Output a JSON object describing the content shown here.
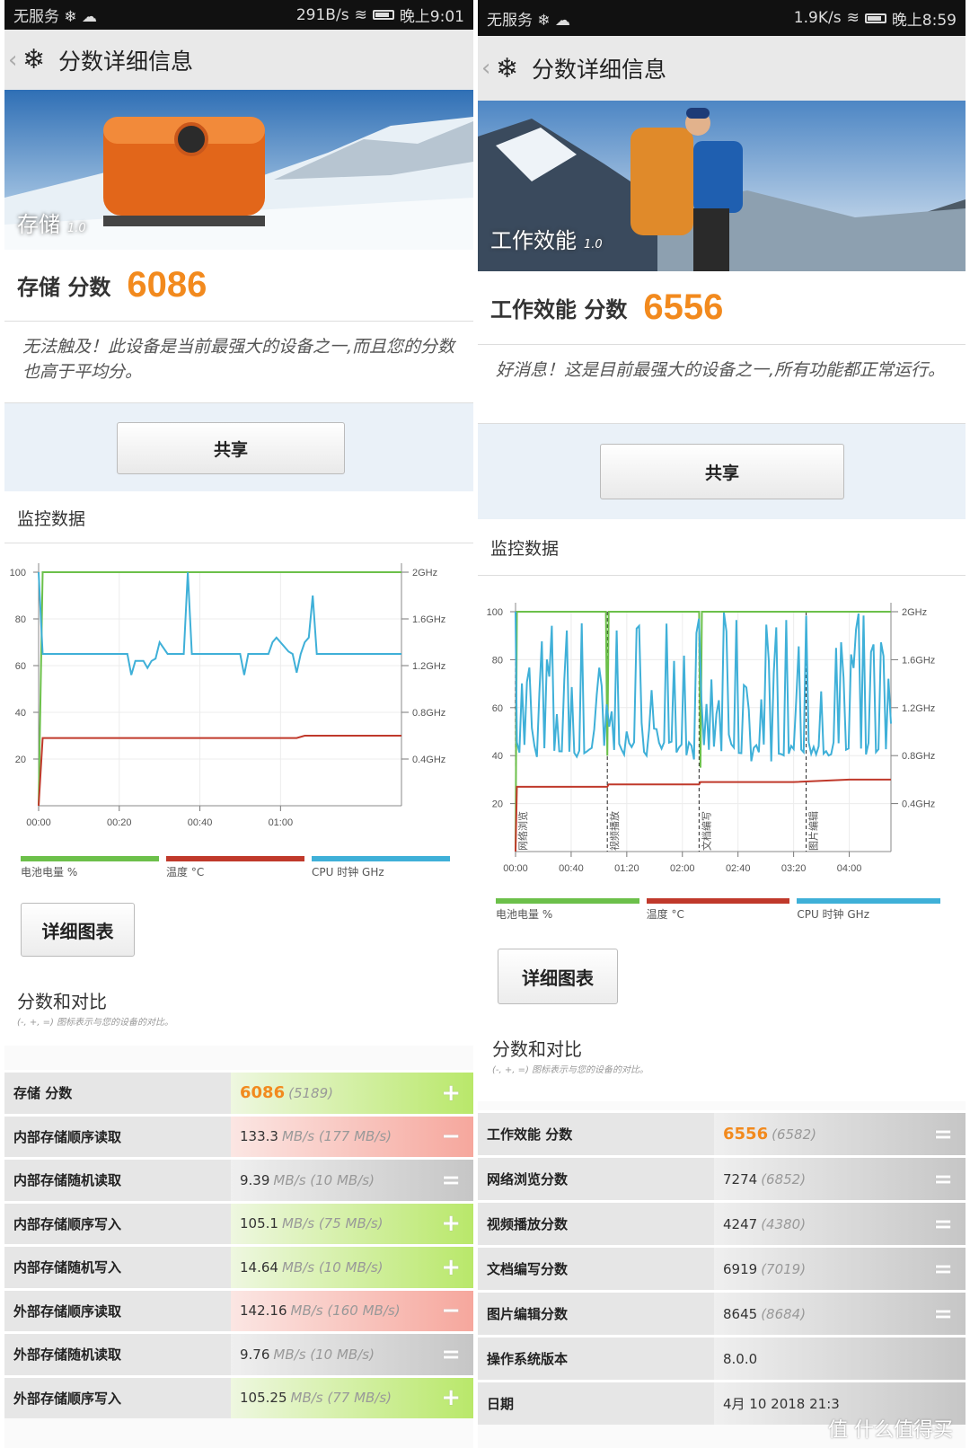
{
  "left": {
    "status": {
      "carrier": "无服务 ❄ ☁",
      "speed": "291B/s",
      "time": "晚上9:01"
    },
    "header_title": "分数详细信息",
    "hero_label": "存储",
    "hero_version": "1.0",
    "score_name": "存储 分数",
    "score_value": "6086",
    "message": "无法触及！此设备是当前最强大的设备之一,而且您的分数也高于平均分。",
    "share_label": "共享",
    "monitor_title": "监控数据",
    "legend": [
      "电池电量 %",
      "温度 °C",
      "CPU 时钟 GHz"
    ],
    "detail_button": "详细图表",
    "compare_title": "分数和对比",
    "compare_sub": "(-, +, =) 图标表示与您的设备的对比。",
    "rows": [
      {
        "k": "存储 分数",
        "v": "6086",
        "u": "(5189)",
        "sym": "+",
        "grad": "plus",
        "big": true
      },
      {
        "k": "内部存储顺序读取",
        "v": "133.3",
        "u": "MB/s (177 MB/s)",
        "sym": "−",
        "grad": "minus"
      },
      {
        "k": "内部存储随机读取",
        "v": "9.39",
        "u": "MB/s (10 MB/s)",
        "sym": "=",
        "grad": "eq"
      },
      {
        "k": "内部存储顺序写入",
        "v": "105.1",
        "u": "MB/s (75 MB/s)",
        "sym": "+",
        "grad": "plus"
      },
      {
        "k": "内部存储随机写入",
        "v": "14.64",
        "u": "MB/s (10 MB/s)",
        "sym": "+",
        "grad": "plus"
      },
      {
        "k": "外部存储顺序读取",
        "v": "142.16",
        "u": "MB/s (160 MB/s)",
        "sym": "−",
        "grad": "minus"
      },
      {
        "k": "外部存储随机读取",
        "v": "9.76",
        "u": "MB/s (10 MB/s)",
        "sym": "=",
        "grad": "eq"
      },
      {
        "k": "外部存储顺序写入",
        "v": "105.25",
        "u": "MB/s (77 MB/s)",
        "sym": "+",
        "grad": "plus"
      }
    ]
  },
  "right": {
    "status": {
      "carrier": "无服务 ❄ ☁",
      "speed": "1.9K/s",
      "time": "晚上8:59"
    },
    "header_title": "分数详细信息",
    "hero_label": "工作效能",
    "hero_version": "1.0",
    "score_name": "工作效能 分数",
    "score_value": "6556",
    "message": "好消息！这是目前最强大的设备之一,所有功能都正常运行。",
    "share_label": "共享",
    "monitor_title": "监控数据",
    "legend": [
      "电池电量 %",
      "温度 °C",
      "CPU 时钟 GHz"
    ],
    "detail_button": "详细图表",
    "compare_title": "分数和对比",
    "compare_sub": "(-, +, =) 图标表示与您的设备的对比。",
    "rows": [
      {
        "k": "工作效能 分数",
        "v": "6556",
        "u": "(6582)",
        "sym": "=",
        "grad": "eq",
        "big": true
      },
      {
        "k": "网络浏览分数",
        "v": "7274",
        "u": "(6852)",
        "sym": "=",
        "grad": "eq"
      },
      {
        "k": "视频播放分数",
        "v": "4247",
        "u": "(4380)",
        "sym": "=",
        "grad": "eq"
      },
      {
        "k": "文档编写分数",
        "v": "6919",
        "u": "(7019)",
        "sym": "=",
        "grad": "eq"
      },
      {
        "k": "图片编辑分数",
        "v": "8645",
        "u": "(8684)",
        "sym": "=",
        "grad": "eq"
      },
      {
        "k": "操作系统版本",
        "v": "8.0.0",
        "u": "",
        "sym": "",
        "grad": "eq"
      },
      {
        "k": "日期",
        "v": "4月 10 2018 21:3",
        "u": "",
        "sym": "",
        "grad": "eq"
      }
    ],
    "watermark": "值 什么值得买"
  },
  "chart_data": [
    {
      "type": "line",
      "x_ticks": [
        "00:00",
        "00:20",
        "00:40",
        "01:00"
      ],
      "x_range_seconds": [
        0,
        90
      ],
      "ylim": [
        0,
        100
      ],
      "y_ticks": [
        20,
        40,
        60,
        80,
        100
      ],
      "y2_ticks": [
        "0.4GHz",
        "0.8GHz",
        "1.2GHz",
        "1.6GHz",
        "2GHz"
      ],
      "series": [
        {
          "name": "电池电量 %",
          "color": "#6cc04a",
          "x": [
            0,
            1,
            90
          ],
          "y": [
            0,
            100,
            100
          ]
        },
        {
          "name": "温度 °C",
          "color": "#c0392b",
          "x": [
            0,
            1,
            64,
            66,
            90
          ],
          "y": [
            0,
            29,
            29,
            30,
            30
          ]
        },
        {
          "name": "CPU 时钟 GHz",
          "color": "#3fb0d8",
          "x": [
            0,
            1,
            2,
            22,
            23,
            24,
            26,
            27,
            28,
            29,
            30,
            32,
            36,
            37,
            38,
            39,
            42,
            45,
            50,
            51,
            52,
            57,
            58,
            59,
            62,
            63,
            64,
            65,
            66,
            67,
            68,
            69,
            70,
            90
          ],
          "y": [
            100,
            65,
            65,
            65,
            56,
            62,
            62,
            59,
            62,
            63,
            70,
            65,
            65,
            100,
            65,
            65,
            65,
            65,
            65,
            56,
            65,
            65,
            70,
            72,
            66,
            65,
            57,
            65,
            70,
            72,
            90,
            65,
            65,
            65
          ]
        }
      ]
    },
    {
      "type": "line",
      "x_ticks": [
        "00:00",
        "00:40",
        "01:20",
        "02:00",
        "02:40",
        "03:20",
        "04:00"
      ],
      "x_range_seconds": [
        0,
        270
      ],
      "ylim": [
        0,
        100
      ],
      "y_ticks": [
        20,
        40,
        60,
        80,
        100
      ],
      "y2_ticks": [
        "0.4GHz",
        "0.8GHz",
        "1.2GHz",
        "1.6GHz",
        "2GHz"
      ],
      "phases": [
        {
          "label": "网络浏览",
          "x": 0
        },
        {
          "label": "视频播放",
          "x": 66
        },
        {
          "label": "文档编写",
          "x": 132
        },
        {
          "label": "图片编辑",
          "x": 209
        }
      ],
      "series": [
        {
          "name": "电池电量 %",
          "color": "#6cc04a",
          "x": [
            0,
            1,
            65,
            66,
            67,
            132,
            133,
            134,
            270
          ],
          "y": [
            0,
            100,
            100,
            40,
            100,
            100,
            35,
            100,
            100
          ]
        },
        {
          "name": "温度 °C",
          "color": "#c0392b",
          "x": [
            0,
            1,
            66,
            67,
            132,
            133,
            200,
            240,
            270
          ],
          "y": [
            0,
            27,
            27,
            28,
            28,
            29,
            29,
            30,
            30
          ]
        },
        {
          "name": "CPU 时钟 GHz",
          "color": "#3fb0d8",
          "seed": 7,
          "x_count": 150,
          "y_min": 36,
          "y_max": 100,
          "dominant": 40
        }
      ]
    }
  ]
}
